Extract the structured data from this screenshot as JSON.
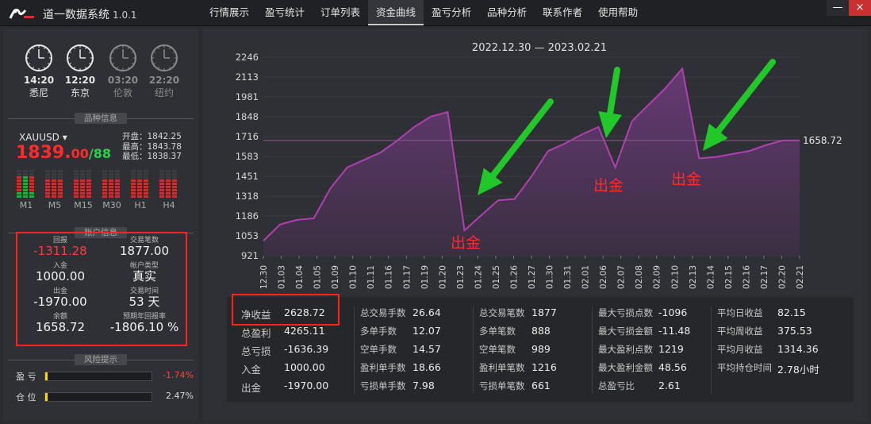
{
  "app": {
    "title": "道一数据系统",
    "version": "1.0.1"
  },
  "menu": [
    "行情展示",
    "盈亏统计",
    "订单列表",
    "资金曲线",
    "盈亏分析",
    "品种分析",
    "联系作者",
    "使用帮助"
  ],
  "menu_active": 3,
  "window_buttons": {
    "minimize": "—",
    "close": "×"
  },
  "clocks": [
    {
      "time": "14:20",
      "city": "悉尼",
      "active": true
    },
    {
      "time": "12:20",
      "city": "东京",
      "active": true
    },
    {
      "time": "03:20",
      "city": "伦敦",
      "active": false
    },
    {
      "time": "22:20",
      "city": "纽约",
      "active": false
    }
  ],
  "section_titles": {
    "quote": "品种信息",
    "account": "账户信息",
    "risk": "风险提示"
  },
  "quote": {
    "symbol": "XAUUSD",
    "price_main": "1839.",
    "price_small": "00",
    "price_sep": "/",
    "price_tail": "88",
    "open": "开盘：1842.25",
    "high": "最高：1843.78",
    "low": "最低：1838.37",
    "timeframes": [
      "M1",
      "M5",
      "M15",
      "M30",
      "H1",
      "H4"
    ]
  },
  "account": [
    {
      "label": "回报",
      "value": "-1311.28",
      "red": true
    },
    {
      "label": "交易笔数",
      "value": "1877.00"
    },
    {
      "label": "入金",
      "value": "1000.00"
    },
    {
      "label": "帐户类型",
      "value": "真实"
    },
    {
      "label": "出金",
      "value": "-1970.00"
    },
    {
      "label": "交易时间",
      "value": "53 天"
    },
    {
      "label": "余额",
      "value": "1658.72"
    },
    {
      "label": "预期年回报率",
      "value": "-1806.10 %"
    }
  ],
  "risk": [
    {
      "label": "盈  亏",
      "value": "-1.74%",
      "fill": 0.02,
      "color": "#ff4040"
    },
    {
      "label": "仓  位",
      "value": "2.47%",
      "fill": 0.025,
      "color": "#dddddd"
    }
  ],
  "chart_data": {
    "type": "area",
    "title": "2022.12.30 — 2023.02.21",
    "y_ticks": [
      921,
      1053,
      1186,
      1318,
      1451,
      1583,
      1716,
      1848,
      1981,
      2113,
      2246
    ],
    "ylim": [
      921,
      2246
    ],
    "x_ticks": [
      "12.30",
      "01.03",
      "01.04",
      "01.05",
      "01.09",
      "01.10",
      "01.11",
      "01.16",
      "01.17",
      "01.19",
      "01.20",
      "01.23",
      "01.24",
      "01.25",
      "01.26",
      "01.27",
      "01.30",
      "01.31",
      "02.01",
      "02.06",
      "02.07",
      "02.08",
      "02.09",
      "02.10",
      "02.13",
      "02.14",
      "02.15",
      "02.16",
      "02.17",
      "02.20",
      "02.21"
    ],
    "series": [
      {
        "values": [
          1020,
          1130,
          1160,
          1170,
          1370,
          1510,
          1560,
          1610,
          1690,
          1780,
          1850,
          1880,
          1090,
          1190,
          1290,
          1300,
          1450,
          1620,
          1670,
          1730,
          1780,
          1510,
          1820,
          1930,
          2040,
          2170,
          1570,
          1580,
          1600,
          1620,
          1660,
          1690,
          1690
        ],
        "color": "#b040b0"
      }
    ],
    "last_value_label": "1658.72",
    "annotations": [
      "出金",
      "出金",
      "出金"
    ],
    "colors": {
      "line": "#b040b0",
      "fill_top": "#6a3a78",
      "fill_bottom": "#3a2f42",
      "arrow": "#22c82a",
      "highlight": "#ff2020"
    }
  },
  "stats": [
    [
      {
        "k": "净收益",
        "v": "2628.72"
      },
      {
        "k": "总盈利",
        "v": "4265.11"
      },
      {
        "k": "总亏损",
        "v": "-1636.39"
      },
      {
        "k": "入金",
        "v": "1000.00"
      },
      {
        "k": "出金",
        "v": "-1970.00"
      }
    ],
    [
      {
        "k": "总交易手数",
        "v": "26.64"
      },
      {
        "k": "多单手数",
        "v": "12.07"
      },
      {
        "k": "空单手数",
        "v": "14.57"
      },
      {
        "k": "盈利单手数",
        "v": "18.66"
      },
      {
        "k": "亏损单手数",
        "v": "7.98"
      }
    ],
    [
      {
        "k": "总交易笔数",
        "v": "1877"
      },
      {
        "k": "多单笔数",
        "v": "888"
      },
      {
        "k": "空单笔数",
        "v": "989"
      },
      {
        "k": "盈利单笔数",
        "v": "1216"
      },
      {
        "k": "亏损单笔数",
        "v": "661"
      }
    ],
    [
      {
        "k": "最大亏损点数",
        "v": "-1096"
      },
      {
        "k": "最大亏损金额",
        "v": "-11.48"
      },
      {
        "k": "最大盈利点数",
        "v": "1219"
      },
      {
        "k": "最大盈利金额",
        "v": "48.56"
      },
      {
        "k": "总盈亏比",
        "v": "2.61"
      }
    ],
    [
      {
        "k": "平均日收益",
        "v": "82.15"
      },
      {
        "k": "平均周收益",
        "v": "375.53"
      },
      {
        "k": "平均月收益",
        "v": "1314.36"
      },
      {
        "k": "平均持仓时间",
        "v": "2.78小时"
      }
    ]
  ]
}
